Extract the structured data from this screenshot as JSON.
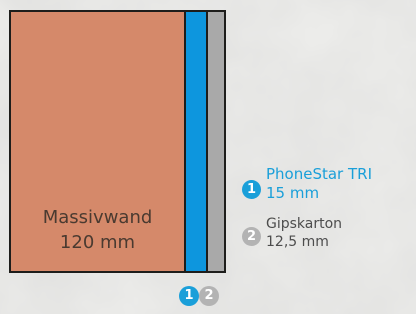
{
  "colors": {
    "massivwand": "#d5896a",
    "phonestar": "#0d96de",
    "gipskarton": "#a9a9a9",
    "label_phonestar": "#1a9fd9",
    "label_gipskarton": "#4d4d4d",
    "background": "#ececea"
  },
  "diagram": {
    "massivwand": {
      "name": "Massivwand",
      "thickness": "120 mm"
    },
    "legend": [
      {
        "number": "1",
        "name": "PhoneStar TRI",
        "thickness": "15 mm"
      },
      {
        "number": "2",
        "name": "Gipskarton",
        "thickness": "12,5 mm"
      }
    ],
    "markers": [
      "1",
      "2"
    ]
  }
}
